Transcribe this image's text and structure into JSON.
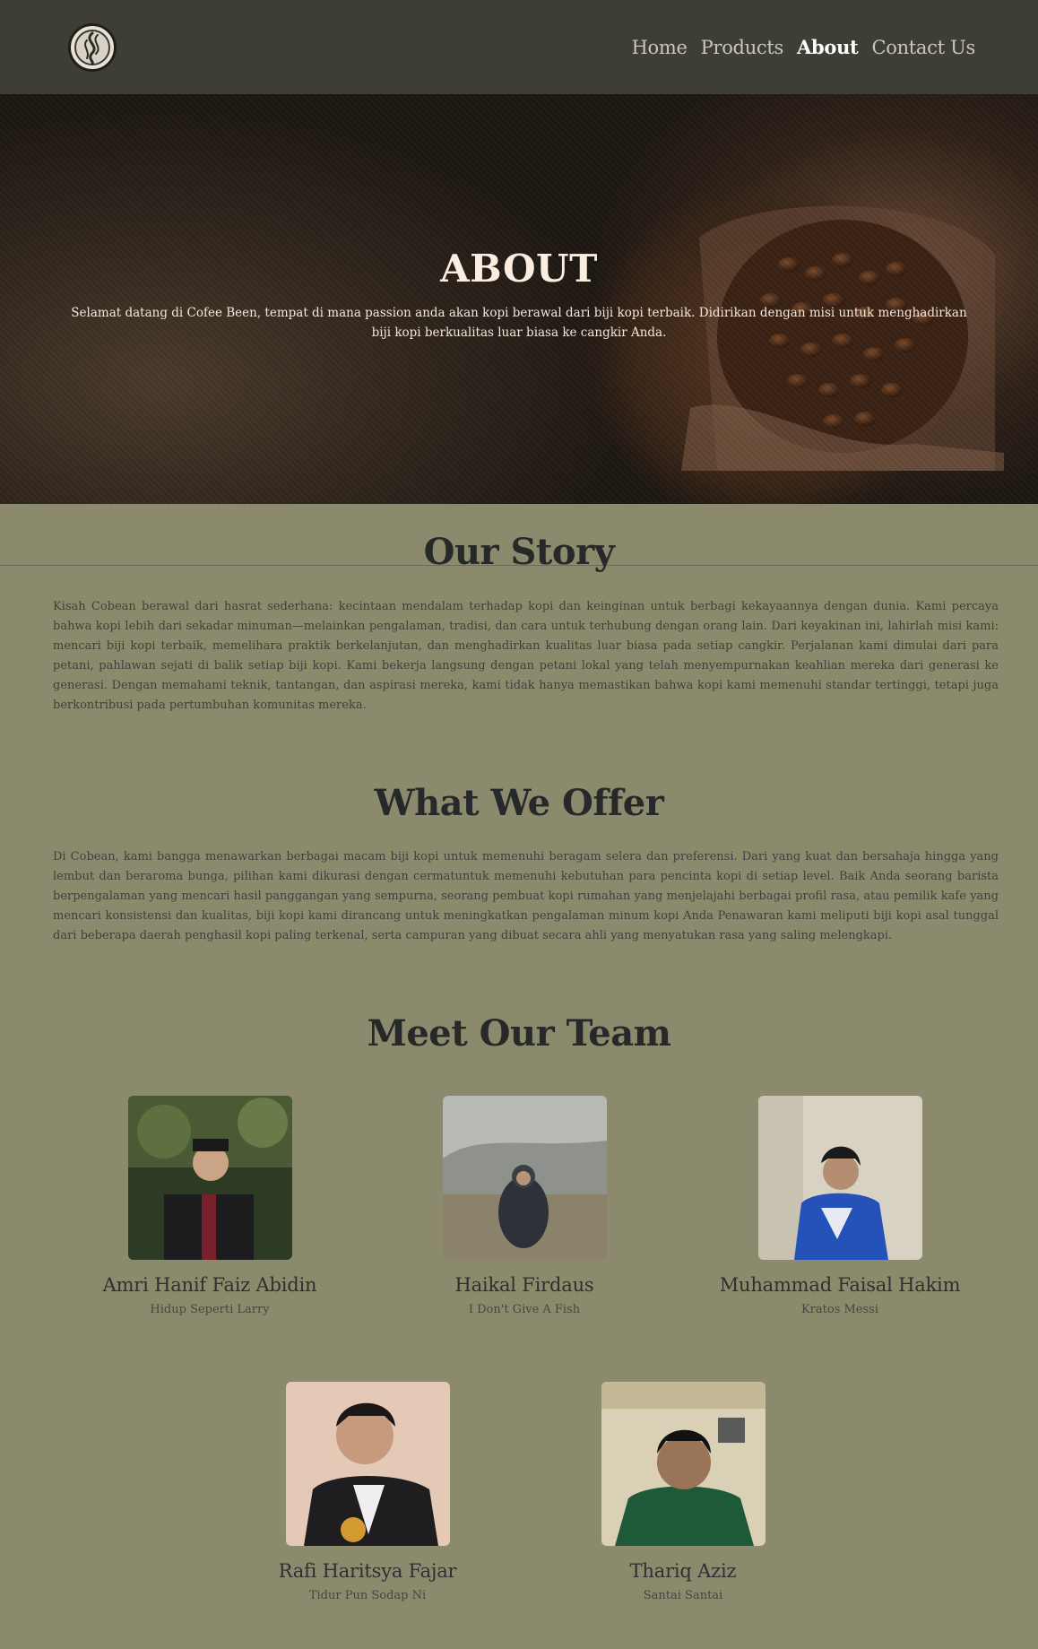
{
  "nav": {
    "logo_alt": "Cobean logo",
    "links": [
      "Home",
      "Products",
      "About",
      "Contact Us"
    ],
    "active": "About"
  },
  "hero": {
    "title": "ABOUT",
    "text": "Selamat datang di Cofee Been, tempat di mana passion anda akan kopi berawal dari biji kopi terbaik. Didirikan dengan misi untuk menghadirkan biji kopi berkualitas luar biasa ke cangkir Anda."
  },
  "story": {
    "title": "Our Story",
    "text": "Kisah Cobean berawal dari hasrat sederhana: kecintaan mendalam terhadap kopi dan keinginan untuk berbagi kekayaannya dengan dunia. Kami percaya bahwa kopi lebih dari sekadar minuman—melainkan pengalaman, tradisi, dan cara untuk terhubung dengan orang lain. Dari keyakinan ini, lahirlah misi kami: mencari biji kopi terbaik, memelihara praktik berkelanjutan, dan menghadirkan kualitas luar biasa pada setiap cangkir. Perjalanan kami dimulai dari para petani, pahlawan sejati di balik setiap biji kopi. Kami bekerja langsung dengan petani lokal yang telah menyempurnakan keahlian mereka dari generasi ke generasi. Dengan memahami teknik, tantangan, dan aspirasi mereka, kami tidak hanya memastikan bahwa kopi kami memenuhi standar tertinggi, tetapi juga berkontribusi pada pertumbuhan komunitas mereka."
  },
  "offer": {
    "title": "What We Offer",
    "text": "Di Cobean, kami bangga menawarkan berbagai macam biji kopi untuk memenuhi beragam selera dan preferensi. Dari yang kuat dan bersahaja hingga yang lembut dan beraroma bunga, pilihan kami dikurasi dengan cermatuntuk memenuhi kebutuhan para pencinta kopi di setiap level. Baik Anda seorang barista berpengalaman yang mencari hasil panggangan yang sempurna, seorang pembuat kopi rumahan yang menjelajahi berbagai profil rasa, atau pemilik kafe yang mencari konsistensi dan kualitas, biji kopi kami dirancang untuk meningkatkan pengalaman minum kopi Anda Penawaran kami meliputi biji kopi asal tunggal dari beberapa daerah penghasil kopi paling terkenal, serta campuran yang dibuat secara ahli yang menyatukan rasa yang saling melengkapi."
  },
  "team": {
    "title": "Meet Our Team",
    "members": [
      {
        "name": "Amri Hanif Faiz Abidin",
        "quote": "Hidup Seperti Larry"
      },
      {
        "name": "Haikal Firdaus",
        "quote": "I Don't Give A Fish"
      },
      {
        "name": "Muhammad Faisal Hakim",
        "quote": "Kratos Messi"
      },
      {
        "name": "Rafi Haritsya Fajar",
        "quote": "Tidur Pun Sodap Ni"
      },
      {
        "name": "Thariq Aziz",
        "quote": "Santai Santai"
      }
    ]
  },
  "colors": {
    "navbar": "#3e3e35",
    "page_bg": "#8c8a6c",
    "heading": "#26282a",
    "hero_text": "#fbeee0"
  }
}
